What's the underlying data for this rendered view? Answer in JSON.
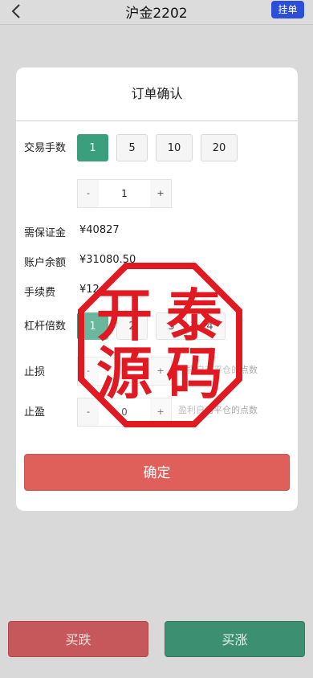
{
  "header": {
    "title": "沪金2202",
    "pending_label": "挂单"
  },
  "dialog": {
    "title": "订单确认",
    "lots": {
      "label": "交易手数",
      "options": [
        "1",
        "5",
        "10",
        "20"
      ],
      "selected_index": 0
    },
    "quantity": {
      "minus": "-",
      "value": "1",
      "plus": "+"
    },
    "margin": {
      "label": "需保证金",
      "value": "¥40827"
    },
    "balance": {
      "label": "账户余额",
      "value": "¥31080.50"
    },
    "fee": {
      "label": "手续费",
      "value": "¥12"
    },
    "leverage": {
      "label": "杠杆倍数",
      "options": [
        "1",
        "2",
        "3",
        "4"
      ],
      "selected_index": 0
    },
    "stop_loss": {
      "label": "止损",
      "minus": "-",
      "value": "0",
      "plus": "+",
      "hint": "亏损自动平仓的点数"
    },
    "take_profit": {
      "label": "止盈",
      "minus": "-",
      "value": "0",
      "plus": "+",
      "hint": "盈利自动平仓的点数"
    },
    "confirm_label": "确定"
  },
  "watermark": {
    "text": [
      "开",
      "泰",
      "源",
      "码"
    ],
    "color": "#e01a22"
  },
  "bottom": {
    "sell_label": "买跌",
    "buy_label": "买涨"
  },
  "colors": {
    "accent_green": "#3a9f7c",
    "confirm_red": "#df605b",
    "pending_blue": "#2b4fd8"
  }
}
